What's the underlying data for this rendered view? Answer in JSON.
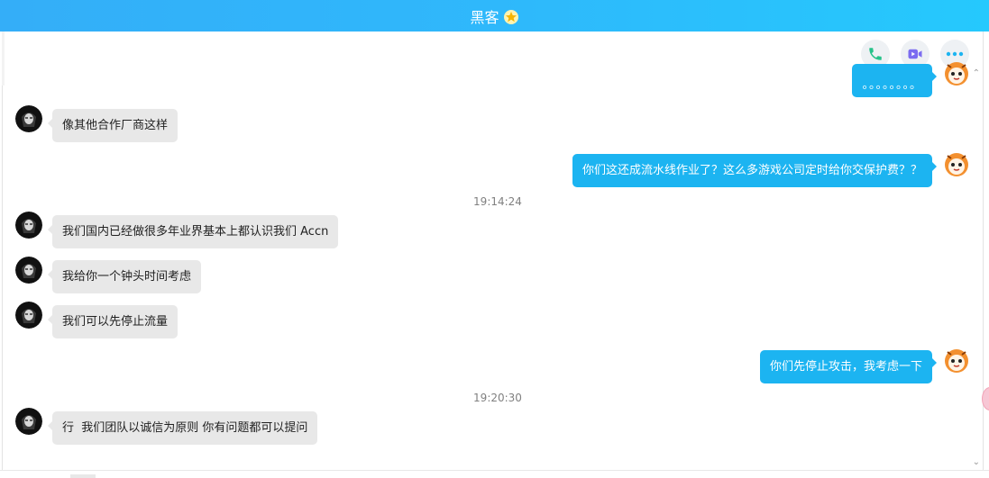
{
  "window": {
    "title": "黑客"
  },
  "toolbar": {
    "phone": "phone-icon",
    "video": "video-icon",
    "more": "more-icon"
  },
  "colors": {
    "titlebar": "#2fb8fb",
    "bubble_me": "#1cb4f1",
    "bubble_other": "#e8e8e8"
  },
  "messages": [
    {
      "side": "right",
      "text": "。。。。。。。。"
    },
    {
      "side": "left",
      "text": "像其他合作厂商这样"
    },
    {
      "side": "right",
      "text": "你们这还成流水线作业了？这么多游戏公司定时给你交保护费？？"
    },
    {
      "type": "time",
      "text": "19:14:24"
    },
    {
      "side": "left",
      "text": "我们国内已经做很多年业界基本上都认识我们 Accn"
    },
    {
      "side": "left",
      "text": "我给你一个钟头时间考虑"
    },
    {
      "side": "left",
      "text": "我们可以先停止流量"
    },
    {
      "side": "right",
      "text": "你们先停止攻击，我考虑一下"
    },
    {
      "type": "time",
      "text": "19:20:30"
    },
    {
      "side": "left",
      "text": "行  我们团队以诚信为原则 你有问题都可以提问"
    }
  ]
}
